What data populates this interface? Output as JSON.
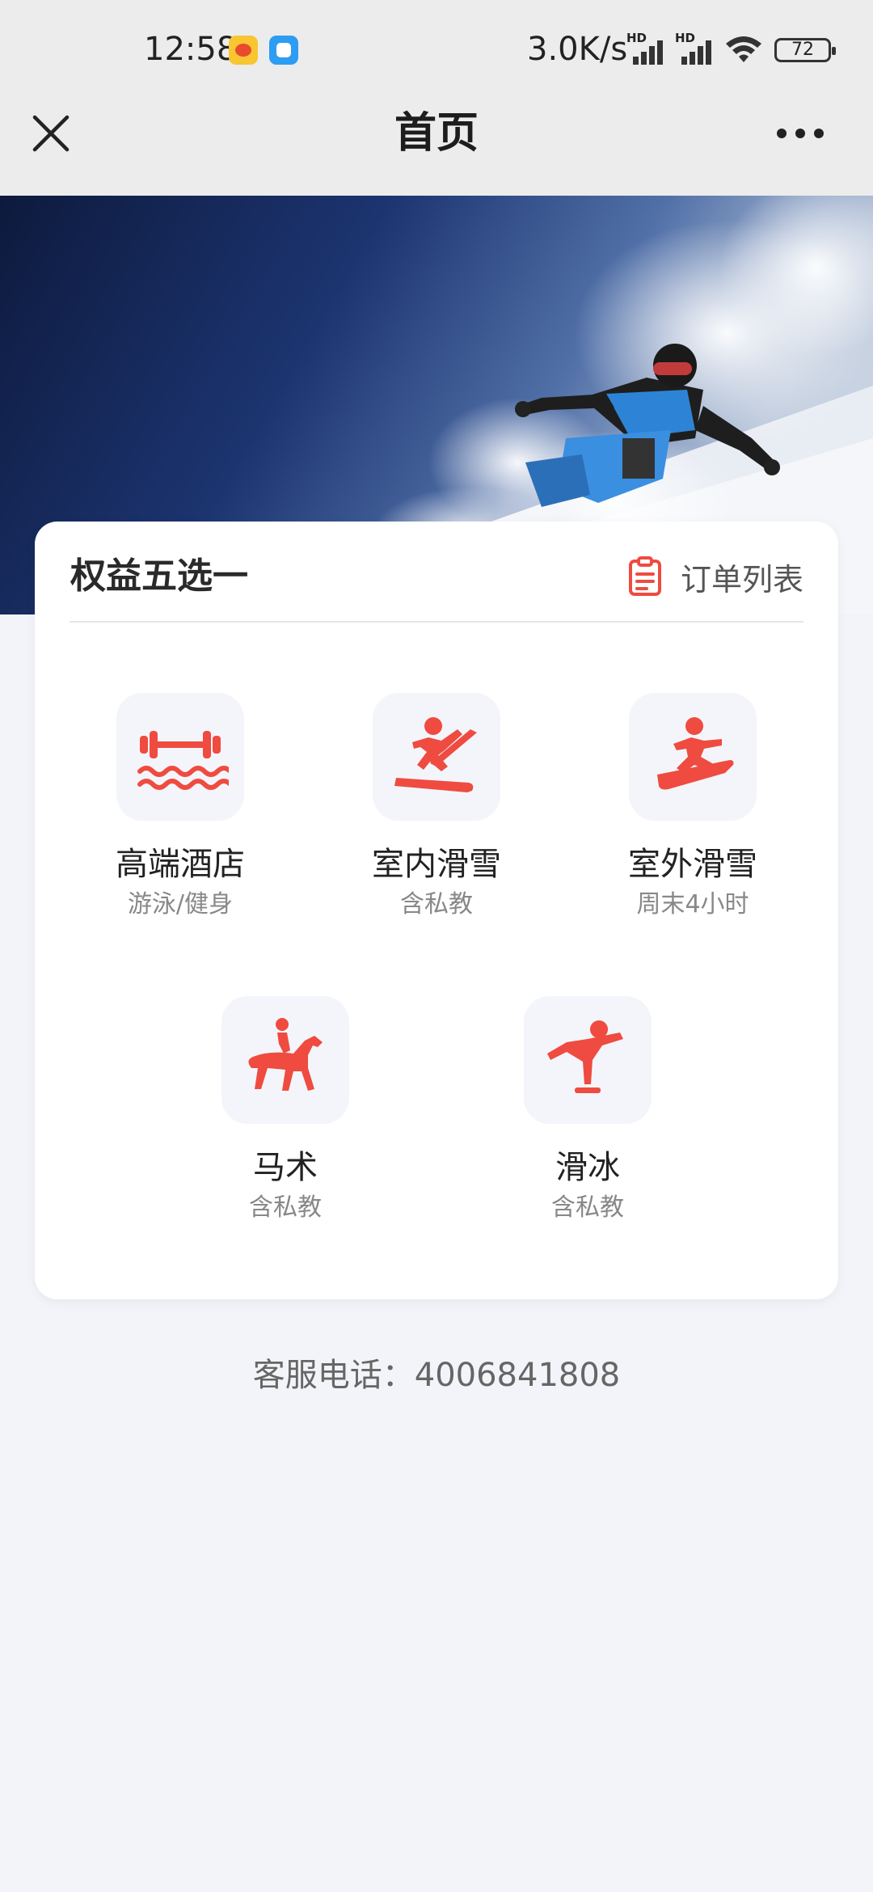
{
  "status_bar": {
    "time": "12:58",
    "network_speed": "3.0K/s",
    "signal_label": "HD",
    "battery": "72"
  },
  "header": {
    "title": "首页",
    "close_icon": "close-icon",
    "more_icon": "more-icon"
  },
  "card": {
    "title": "权益五选一",
    "order_link": "订单列表",
    "accent_color": "#ef4b40",
    "options": [
      {
        "name": "高端酒店",
        "sub": "游泳/健身",
        "icon": "fitness-swim-icon"
      },
      {
        "name": "室内滑雪",
        "sub": "含私教",
        "icon": "indoor-ski-icon"
      },
      {
        "name": "室外滑雪",
        "sub": "周末4小时",
        "icon": "outdoor-ski-icon"
      },
      {
        "name": "马术",
        "sub": "含私教",
        "icon": "horse-riding-icon"
      },
      {
        "name": "滑冰",
        "sub": "含私教",
        "icon": "ice-skating-icon"
      }
    ]
  },
  "footer": {
    "hotline": "客服电话：4006841808"
  }
}
